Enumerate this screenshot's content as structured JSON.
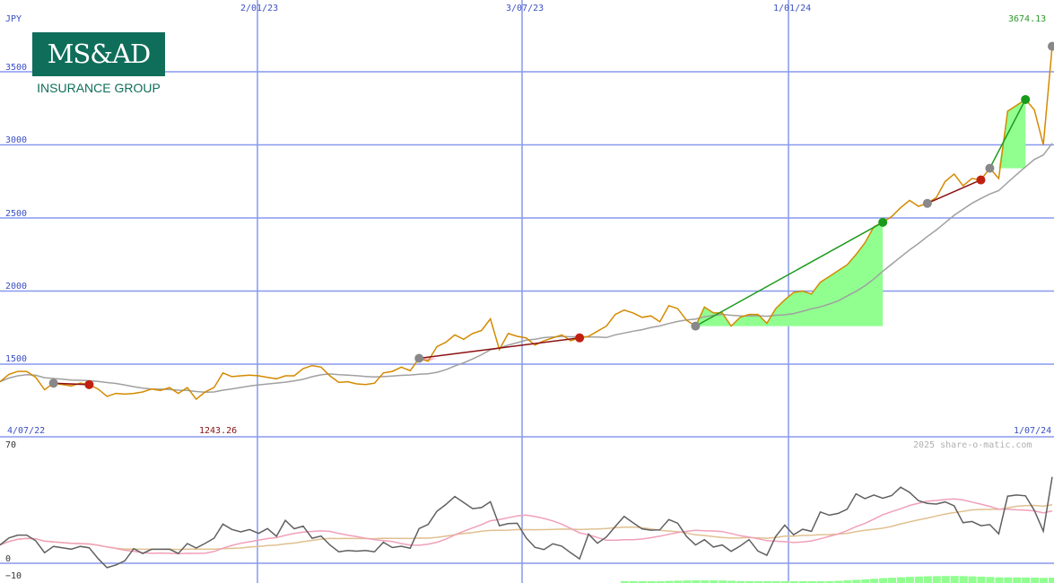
{
  "header": {
    "currency": "JPY",
    "last_price": "3674.13",
    "low_price": "1243.26",
    "start_date": "4/07/22",
    "end_date": "1/07/24",
    "credit": "2025 share-o-matic.com"
  },
  "logo": {
    "brand": "MS&AD",
    "tagline": "INSURANCE GROUP"
  },
  "colors": {
    "price_line": "#d48a00",
    "avg_line": "#a0a0a0",
    "gain_fill": "#90ff90",
    "loss_fill": "#ffb0c8",
    "gain_trade": "#1a9a1a",
    "loss_trade": "#8b1010",
    "grid": "#8899ee",
    "osc_line": "#606060",
    "osc_pink": "#f0a0b8",
    "osc_tan": "#e0c090"
  },
  "chart_data": {
    "type": "line",
    "x_tick_labels": [
      "2/01/23",
      "3/07/23",
      "1/01/24"
    ],
    "y_tick_labels": [
      "1500",
      "2000",
      "2500",
      "3000",
      "3500"
    ],
    "ylim": [
      1140,
      3780
    ],
    "x": [
      "2022-07-04",
      "2022-07-11",
      "2022-07-18",
      "2022-07-25",
      "2022-08-01",
      "2022-08-08",
      "2022-08-15",
      "2022-08-22",
      "2022-08-29",
      "2022-09-05",
      "2022-09-12",
      "2022-09-19",
      "2022-09-26",
      "2022-10-03",
      "2022-10-10",
      "2022-10-17",
      "2022-10-24",
      "2022-10-31",
      "2022-11-07",
      "2022-11-14",
      "2022-11-21",
      "2022-11-28",
      "2022-12-05",
      "2022-12-12",
      "2022-12-19",
      "2022-12-26",
      "2023-01-02",
      "2023-01-09",
      "2023-01-16",
      "2023-01-23",
      "2023-01-30",
      "2023-02-06",
      "2023-02-13",
      "2023-02-20",
      "2023-02-27",
      "2023-03-06",
      "2023-03-13",
      "2023-03-20",
      "2023-03-27",
      "2023-04-03",
      "2023-04-10",
      "2023-04-17",
      "2023-04-24",
      "2023-05-01",
      "2023-05-08",
      "2023-05-15",
      "2023-05-22",
      "2023-05-29",
      "2023-06-05",
      "2023-06-12",
      "2023-06-19",
      "2023-06-26",
      "2023-07-03",
      "2023-07-10",
      "2023-07-17",
      "2023-07-24",
      "2023-07-31",
      "2023-08-07",
      "2023-08-14",
      "2023-08-21",
      "2023-08-28",
      "2023-09-04",
      "2023-09-11",
      "2023-09-18",
      "2023-09-25",
      "2023-10-02",
      "2023-10-09",
      "2023-10-16",
      "2023-10-23",
      "2023-10-30",
      "2023-11-06",
      "2023-11-13",
      "2023-11-20",
      "2023-11-27",
      "2023-12-04",
      "2023-12-11",
      "2023-12-18",
      "2023-12-25",
      "2024-01-01",
      "2024-01-08",
      "2024-01-15",
      "2024-01-22",
      "2024-01-29",
      "2024-02-05",
      "2024-02-12",
      "2024-02-19",
      "2024-02-26",
      "2024-03-04",
      "2024-03-11",
      "2024-03-18",
      "2024-03-25",
      "2024-04-01",
      "2024-04-08",
      "2024-04-15",
      "2024-04-22",
      "2024-04-29",
      "2024-05-06",
      "2024-05-13",
      "2024-05-20",
      "2024-05-27",
      "2024-06-03",
      "2024-06-10",
      "2024-06-17",
      "2024-06-24",
      "2024-07-01"
    ],
    "series": [
      {
        "values": [
          1380,
          1430,
          1450,
          1450,
          1410,
          1325,
          1370,
          1360,
          1350,
          1370,
          1360,
          1330,
          1280,
          1300,
          1295,
          1300,
          1310,
          1330,
          1320,
          1340,
          1300,
          1340,
          1260,
          1310,
          1340,
          1440,
          1415,
          1420,
          1425,
          1420,
          1410,
          1400,
          1420,
          1420,
          1470,
          1490,
          1480,
          1420,
          1375,
          1380,
          1365,
          1360,
          1370,
          1440,
          1450,
          1480,
          1455,
          1540,
          1520,
          1620,
          1650,
          1700,
          1670,
          1710,
          1730,
          1810,
          1600,
          1710,
          1690,
          1680,
          1630,
          1660,
          1680,
          1700,
          1660,
          1680,
          1690,
          1725,
          1760,
          1840,
          1870,
          1850,
          1820,
          1830,
          1790,
          1900,
          1880,
          1800,
          1760,
          1890,
          1850,
          1850,
          1760,
          1820,
          1840,
          1840,
          1780,
          1880,
          1940,
          1990,
          2000,
          1980,
          2060,
          2100,
          2140,
          2180,
          2250,
          2330,
          2440,
          2470,
          2510,
          2570,
          2620,
          2580,
          2600,
          2640,
          2750,
          2800,
          2720,
          2770,
          2760,
          2840,
          2770,
          3230,
          3270,
          3310,
          3240,
          3000,
          3674
        ]
      }
    ]
  }
}
